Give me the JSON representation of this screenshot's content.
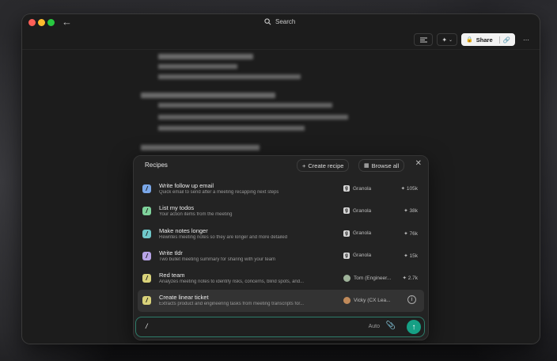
{
  "window": {
    "back_icon": "arrow-left-icon",
    "search_label": "Search",
    "toolbar": {
      "share_label": "Share"
    }
  },
  "document": {
    "blurred": true
  },
  "recipes": {
    "title": "Recipes",
    "create_label": "Create recipe",
    "browse_label": "Browse all",
    "items": [
      {
        "title": "Write follow up email",
        "description": "Quick email to send after a meeting recapping next steps",
        "owner": "Granola",
        "count": "105k",
        "icon_color": "#7aa7e8"
      },
      {
        "title": "List my todos",
        "description": "Your action items from the meeting",
        "owner": "Granola",
        "count": "38k",
        "icon_color": "#7fd29b"
      },
      {
        "title": "Make notes longer",
        "description": "Rewrites meeting notes so they are longer and more detailed",
        "owner": "Granola",
        "count": "76k",
        "icon_color": "#6fc7c9"
      },
      {
        "title": "Write tldr",
        "description": "Two bullet meeting summary for sharing with your team",
        "owner": "Granola",
        "count": "15k",
        "icon_color": "#b7a3e6"
      },
      {
        "title": "Red team",
        "description": "Analyzes meeting notes to identify risks, concerns, blind spots, and...",
        "owner": "Tom (Engineer...",
        "count": "2.7k",
        "icon_color": "#d9d27a"
      },
      {
        "title": "Create linear ticket",
        "description": "Extracts product and engineering tasks from meeting transcripts for...",
        "owner": "Vicky (CX Lea...",
        "count": "",
        "icon_color": "#d9d27a"
      }
    ]
  },
  "composer": {
    "input_value": "/",
    "model_label": "Auto"
  }
}
